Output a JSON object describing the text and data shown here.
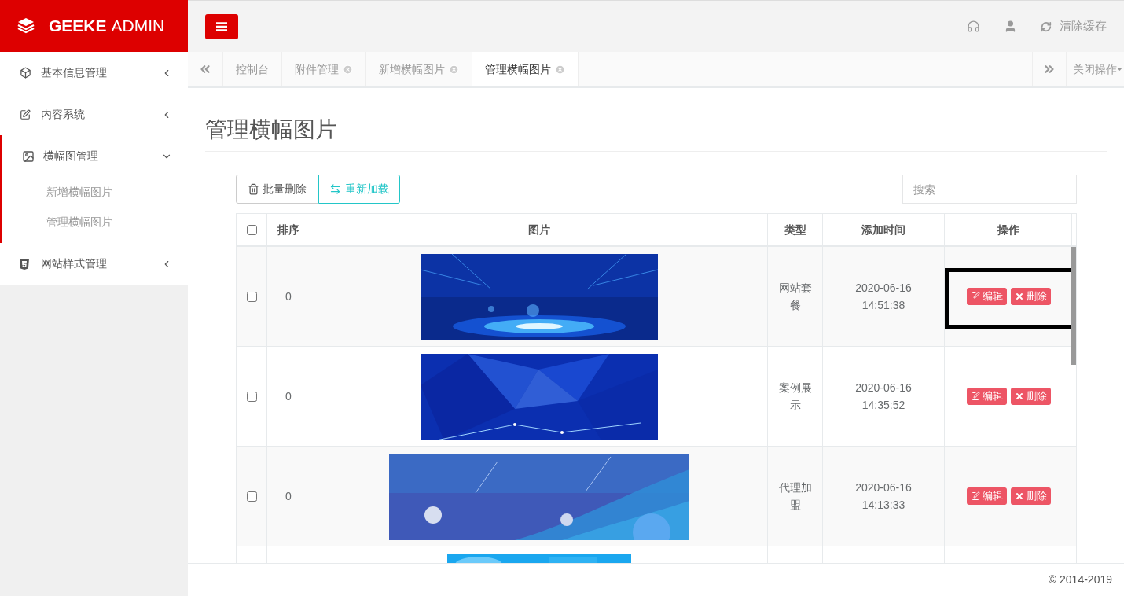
{
  "brand": {
    "name_bold": "GEEKE",
    "name_light": "ADMIN"
  },
  "top_bar": {
    "clear_cache": "清除缓存"
  },
  "sidebar": {
    "items": [
      {
        "label": "基本信息管理",
        "expanded": false
      },
      {
        "label": "内容系统",
        "expanded": false
      },
      {
        "label": "横幅图管理",
        "expanded": true,
        "children": [
          {
            "label": "新增横幅图片"
          },
          {
            "label": "管理横幅图片"
          }
        ]
      },
      {
        "label": "网站样式管理",
        "expanded": false
      }
    ]
  },
  "tabs": [
    {
      "label": "控制台",
      "closable": false,
      "selected": false
    },
    {
      "label": "附件管理",
      "closable": true,
      "selected": false
    },
    {
      "label": "新增横幅图片",
      "closable": true,
      "selected": false
    },
    {
      "label": "管理横幅图片",
      "closable": true,
      "selected": true
    }
  ],
  "close_menu": "关闭操作",
  "page_title": "管理横幅图片",
  "toolbar": {
    "batch_delete": "批量删除",
    "reload": "重新加载",
    "search_placeholder": "搜索"
  },
  "table": {
    "select_all_checked": false,
    "columns": [
      "排序",
      "图片",
      "类型",
      "添加时间",
      "操作"
    ],
    "rows": [
      {
        "checked": false,
        "order": "0",
        "image": {
          "kind": "picture"
        },
        "type": "网站套餐",
        "date": "2020-06-16",
        "time": "14:51:38",
        "edit": "编辑",
        "delete": "删除",
        "highlighted": true
      },
      {
        "checked": false,
        "order": "0",
        "image": {
          "kind": "picture"
        },
        "type": "案例展示",
        "date": "2020-06-16",
        "time": "14:35:52",
        "edit": "编辑",
        "delete": "删除",
        "highlighted": false
      },
      {
        "checked": false,
        "order": "0",
        "image": {
          "kind": "picture"
        },
        "type": "代理加盟",
        "date": "2020-06-16",
        "time": "14:13:33",
        "edit": "编辑",
        "delete": "删除",
        "highlighted": false
      },
      {
        "image": {
          "kind": "picture"
        }
      }
    ]
  },
  "footer": "© 2014-2019"
}
